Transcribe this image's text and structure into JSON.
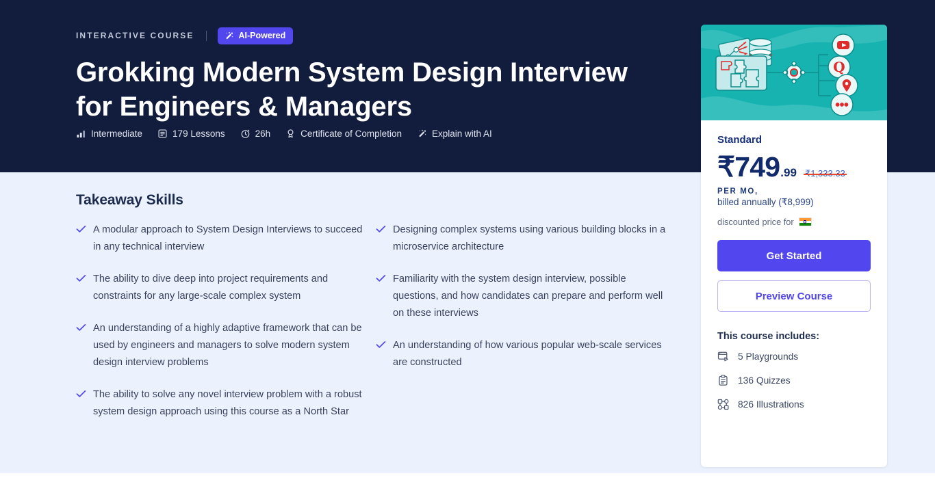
{
  "hero": {
    "eyebrow": "INTERACTIVE COURSE",
    "ai_badge": {
      "label": "AI-Powered",
      "icon": "magic-wand-icon",
      "bg_color": "#5246ee"
    },
    "title": "Grokking Modern System Design Interview for Engineers & Managers",
    "background_color": "#121d3e",
    "meta": [
      {
        "icon": "difficulty-bars-icon",
        "label": "Intermediate"
      },
      {
        "icon": "lessons-icon",
        "label": "179 Lessons"
      },
      {
        "icon": "clock-icon",
        "label": "26h"
      },
      {
        "icon": "certificate-icon",
        "label": "Certificate of Completion"
      },
      {
        "icon": "magic-wand-icon",
        "label": "Explain with AI"
      }
    ]
  },
  "main": {
    "background_color": "#ebf2fd",
    "section_title": "Takeaway Skills",
    "skills_left": [
      "A modular approach to System Design Interviews to succeed in any technical interview",
      "The ability to dive deep into project requirements and constraints for any large-scale complex system",
      "An understanding of a highly adaptive framework that can be used by engineers and managers to solve modern system design interview problems",
      "The ability to solve any novel interview problem with a robust system design approach using this course as a North Star"
    ],
    "skills_right": [
      "Designing complex systems using various building blocks in a microservice architecture",
      "Familiarity with the system design interview, possible questions, and how candidates can prepare and perform well on these interviews",
      "An understanding of how various popular web-scale services are constructed"
    ],
    "check_icon": "check-icon",
    "check_color": "#5246ee"
  },
  "pricing_card": {
    "artwork": {
      "icon": "system-design-diagram-illustration",
      "background_color": "#17b3b0",
      "accent_color": "#e02b2b"
    },
    "plan_name": "Standard",
    "price_main": "₹749",
    "price_cents": ".99",
    "price_old": "₹1,333.33",
    "price_color": "#102a6b",
    "strike_color": "#e8452c",
    "per_period": "PER MO,",
    "billed_note": "billed annually (₹8,999)",
    "discount_note": "discounted price for",
    "discount_flag": "india-flag-icon",
    "primary_button": "Get Started",
    "secondary_button": "Preview Course",
    "includes_title": "This course includes:",
    "includes": [
      {
        "icon": "playground-icon",
        "label": "5 Playgrounds"
      },
      {
        "icon": "quiz-clipboard-icon",
        "label": "136 Quizzes"
      },
      {
        "icon": "illustrations-nodes-icon",
        "label": "826 Illustrations"
      }
    ]
  }
}
